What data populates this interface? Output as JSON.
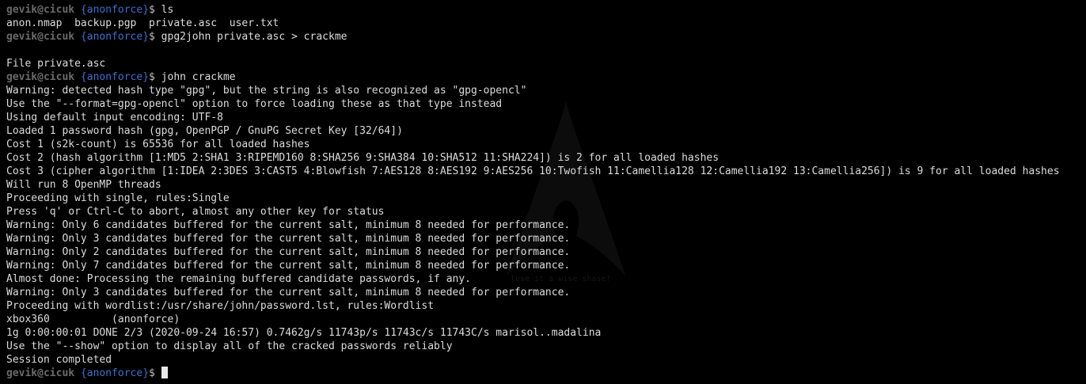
{
  "terminal": {
    "colors": {
      "background": "#000000",
      "text": "#dcdcdc",
      "prompt_user": "#6a6a6a",
      "prompt_dir": "#3d6fd0"
    },
    "prompt": {
      "user_host": "gevik@cicuk",
      "directory": "{anonforce}",
      "symbol": "$"
    },
    "watermark": {
      "icon": "arch-linux-logo",
      "text": "luse it a wise shase!"
    },
    "lines": [
      {
        "type": "cmd",
        "command": "ls"
      },
      {
        "type": "out",
        "text": "anon.nmap  backup.pgp  private.asc  user.txt"
      },
      {
        "type": "cmd",
        "command": "gpg2john private.asc > crackme"
      },
      {
        "type": "out",
        "text": ""
      },
      {
        "type": "out",
        "text": "File private.asc"
      },
      {
        "type": "cmd",
        "command": "john crackme"
      },
      {
        "type": "out",
        "text": "Warning: detected hash type \"gpg\", but the string is also recognized as \"gpg-opencl\""
      },
      {
        "type": "out",
        "text": "Use the \"--format=gpg-opencl\" option to force loading these as that type instead"
      },
      {
        "type": "out",
        "text": "Using default input encoding: UTF-8"
      },
      {
        "type": "out",
        "text": "Loaded 1 password hash (gpg, OpenPGP / GnuPG Secret Key [32/64])"
      },
      {
        "type": "out",
        "text": "Cost 1 (s2k-count) is 65536 for all loaded hashes"
      },
      {
        "type": "out",
        "text": "Cost 2 (hash algorithm [1:MD5 2:SHA1 3:RIPEMD160 8:SHA256 9:SHA384 10:SHA512 11:SHA224]) is 2 for all loaded hashes"
      },
      {
        "type": "out",
        "text": "Cost 3 (cipher algorithm [1:IDEA 2:3DES 3:CAST5 4:Blowfish 7:AES128 8:AES192 9:AES256 10:Twofish 11:Camellia128 12:Camellia192 13:Camellia256]) is 9 for all loaded hashes"
      },
      {
        "type": "out",
        "text": "Will run 8 OpenMP threads"
      },
      {
        "type": "out",
        "text": "Proceeding with single, rules:Single"
      },
      {
        "type": "out",
        "text": "Press 'q' or Ctrl-C to abort, almost any other key for status"
      },
      {
        "type": "out",
        "text": "Warning: Only 6 candidates buffered for the current salt, minimum 8 needed for performance."
      },
      {
        "type": "out",
        "text": "Warning: Only 3 candidates buffered for the current salt, minimum 8 needed for performance."
      },
      {
        "type": "out",
        "text": "Warning: Only 2 candidates buffered for the current salt, minimum 8 needed for performance."
      },
      {
        "type": "out",
        "text": "Warning: Only 7 candidates buffered for the current salt, minimum 8 needed for performance."
      },
      {
        "type": "out",
        "text": "Almost done: Processing the remaining buffered candidate passwords, if any."
      },
      {
        "type": "out",
        "text": "Warning: Only 3 candidates buffered for the current salt, minimum 8 needed for performance."
      },
      {
        "type": "out",
        "text": "Proceeding with wordlist:/usr/share/john/password.lst, rules:Wordlist"
      },
      {
        "type": "out",
        "text": "xbox360          (anonforce)"
      },
      {
        "type": "out",
        "text": "1g 0:00:00:01 DONE 2/3 (2020-09-24 16:57) 0.7462g/s 11743p/s 11743c/s 11743C/s marisol..madalina"
      },
      {
        "type": "out",
        "text": "Use the \"--show\" option to display all of the cracked passwords reliably"
      },
      {
        "type": "out",
        "text": "Session completed"
      },
      {
        "type": "cmd",
        "command": "",
        "cursor": true
      }
    ]
  }
}
